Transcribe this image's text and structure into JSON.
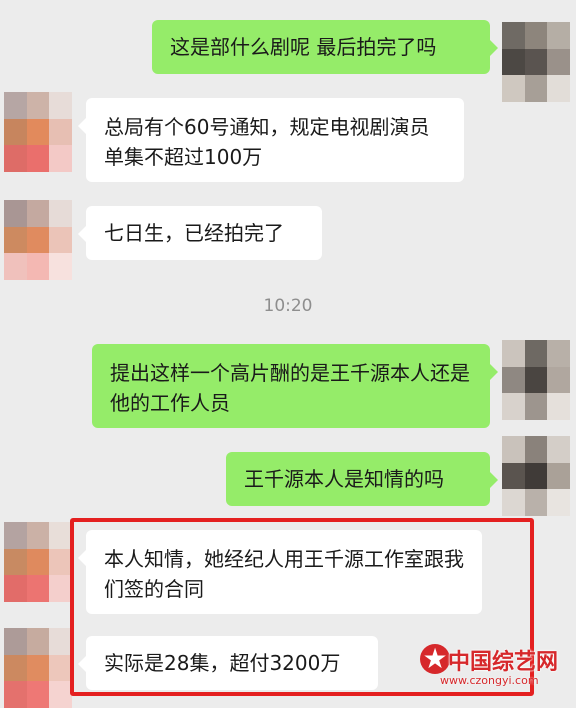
{
  "timestamp": "10:20",
  "messages": [
    {
      "side": "out",
      "text": "这是部什么剧呢 最后拍完了吗"
    },
    {
      "side": "in",
      "text": "总局有个60号通知，规定电视剧演员单集不超过100万"
    },
    {
      "side": "in",
      "text": "七日生，已经拍完了"
    },
    {
      "side": "out",
      "text": "提出这样一个高片酬的是王千源本人还是他的工作人员"
    },
    {
      "side": "out",
      "text": "王千源本人是知情的吗"
    },
    {
      "side": "in",
      "text": "本人知情，她经纪人用王千源工作室跟我们签的合同"
    },
    {
      "side": "in",
      "text": "实际是28集，超付3200万"
    }
  ],
  "watermark": {
    "title": "中国综艺网",
    "url": "www.czongyi.com"
  },
  "colors": {
    "outgoing_bubble": "#95ec69",
    "incoming_bubble": "#ffffff",
    "background": "#ececec",
    "highlight_border": "#e42020"
  }
}
